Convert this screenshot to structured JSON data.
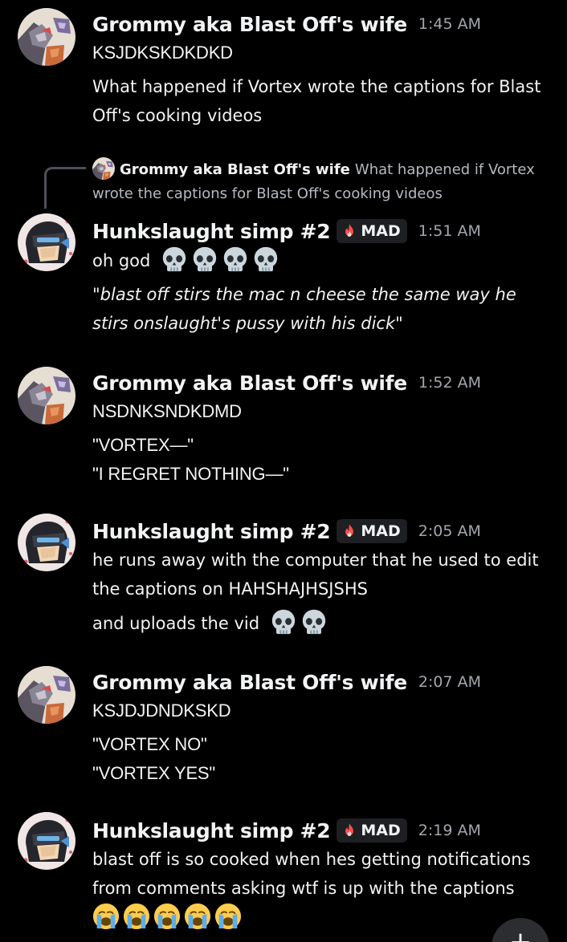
{
  "users": {
    "grommy": {
      "name": "Grommy aka Blast Off's wife",
      "avatar_icon": "blast-off-avatar-icon"
    },
    "hunk": {
      "name": "Hunkslaught simp #2",
      "avatar_icon": "masked-bot-avatar-icon",
      "tag": "MAD",
      "tag_icon": "flame-icon"
    }
  },
  "messages": [
    {
      "time": "1:45 AM",
      "lines": [
        "KSJDKSKDKDKD",
        "What happened if Vortex wrote the captions for Blast",
        "Off's cooking videos"
      ]
    },
    {
      "time": "1:51 AM",
      "lines": [
        "oh god",
        "\"blast off stirs the mac n cheese the same way he",
        "stirs onslaught's pussy with his dick\""
      ]
    },
    {
      "time": "1:52 AM",
      "lines": [
        "NSDNKSNDKDMD",
        "\"VORTEX—\"",
        "\"I REGRET NOTHING—\""
      ]
    },
    {
      "time": "2:05 AM",
      "lines": [
        "he runs away with the computer that he used to edit",
        "the captions on HAHSHAJHSJSHS",
        "and uploads the vid"
      ]
    },
    {
      "time": "2:07 AM",
      "lines": [
        "KSJDJDNDKSKD",
        "\"VORTEX NO\"",
        "\"VORTEX YES\""
      ]
    },
    {
      "time": "2:19 AM",
      "lines": [
        "blast off is so cooked when hes getting notifications",
        "from comments asking wtf is up with the captions"
      ]
    }
  ],
  "reply": {
    "name": "Grommy aka Blast Off's wife",
    "line1": "What happened if Vortex",
    "line2": "wrote the captions for Blast Off's cooking videos"
  },
  "emoji": {
    "skull": "skull-emoji",
    "sob": "loudly-crying-emoji"
  },
  "colors": {
    "background": "#000000",
    "text": "#f2f3f5",
    "muted": "#a3a6ad",
    "tag_bg": "#1e1f22"
  },
  "fab_label": "+"
}
